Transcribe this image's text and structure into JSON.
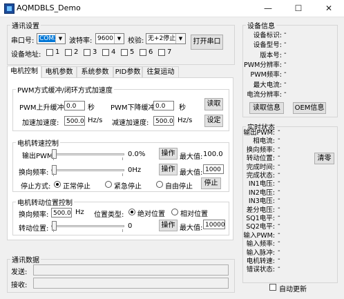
{
  "window": {
    "title": "AQMDBLS_Demo",
    "minimize": "—",
    "maximize": "☐",
    "close": "✕"
  },
  "comm": {
    "legend": "通讯设置",
    "port_label": "串口号:",
    "port_value": "COM1",
    "baud_label": "波特率:",
    "baud_value": "9600",
    "parity_label": "校验:",
    "parity_value": "无+2停止",
    "open_button": "打开串口",
    "addr_label": "设备地址:",
    "addresses": [
      "1",
      "2",
      "3",
      "4",
      "5",
      "6",
      "7"
    ]
  },
  "tabs": [
    "电机控制",
    "电机参数",
    "系统参数",
    "PID参数",
    "往复运动"
  ],
  "pwm": {
    "legend": "PWM方式缓冲/闭环方式加速度",
    "rise_label": "PWM上升缓冲:",
    "rise_value": "0.0",
    "rise_unit": "秒",
    "fall_label": "PWM下降缓冲:",
    "fall_value": "0.0",
    "fall_unit": "秒",
    "read_button": "读取",
    "accel_label": "加速加速度:",
    "accel_value": "500.0",
    "accel_unit": "Hz/s",
    "decel_label": "减速加速度:",
    "decel_value": "500.0",
    "decel_unit": "Hz/s",
    "set_button": "设定"
  },
  "speed": {
    "legend": "电机转速控制",
    "pwm_label": "输出PWM:",
    "pwm_readout": "0.0%",
    "pwm_level": 0.0,
    "pwm_op": "操作",
    "pwm_max_label": "最大值:",
    "pwm_max_value": "100.0",
    "freq_label": "换向频率:",
    "freq_readout": "0Hz",
    "freq_level": 0.0,
    "freq_op": "操作",
    "freq_max_label": "最大值:",
    "freq_max_value": "1000",
    "stop_label": "停止方式:",
    "stop_options": [
      "正常停止",
      "紧急停止",
      "自由停止"
    ],
    "stop_selected": 0,
    "stop_button": "停止"
  },
  "position": {
    "legend": "电机转动位置控制",
    "freq_label": "换向频率:",
    "freq_value": "500.0",
    "freq_unit": "Hz",
    "type_label": "位置类型:",
    "type_options": [
      "绝对位置",
      "相对位置"
    ],
    "type_selected": 0,
    "pos_label": "转动位置:",
    "pos_readout": "0",
    "pos_level": 0.0,
    "pos_op": "操作",
    "pos_max_label": "最大值:",
    "pos_max_value": "10000"
  },
  "comm_data": {
    "legend": "通讯数据",
    "send_label": "发送:",
    "recv_label": "接收:"
  },
  "device_info": {
    "legend": "设备信息",
    "rows": [
      {
        "label": "设备标识:",
        "value": "-"
      },
      {
        "label": "设备型号:",
        "value": "-"
      },
      {
        "label": "版本号:",
        "value": "-"
      },
      {
        "label": "PWM分辨率:",
        "value": "-"
      },
      {
        "label": "PWM频率:",
        "value": "-"
      },
      {
        "label": "最大电流:",
        "value": "-"
      },
      {
        "label": "电流分辨率:",
        "value": "-"
      }
    ],
    "read_button": "读取信息",
    "oem_button": "OEM信息"
  },
  "realtime": {
    "legend": "实时状态",
    "rows": [
      {
        "label": "输出PWM:",
        "value": "-"
      },
      {
        "label": "相电流:",
        "value": "-"
      },
      {
        "label": "换向频率:",
        "value": "-"
      },
      {
        "label": "转动位置:",
        "value": "-"
      },
      {
        "label": "完成时间:",
        "value": "-"
      },
      {
        "label": "完成状态:",
        "value": "-"
      },
      {
        "label": "IN1电压:",
        "value": "-"
      },
      {
        "label": "IN2电压:",
        "value": "-"
      },
      {
        "label": "IN3电压:",
        "value": "-"
      },
      {
        "label": "差分电压:",
        "value": "-"
      },
      {
        "label": "SQ1电平:",
        "value": "-"
      },
      {
        "label": "SQ2电平:",
        "value": "-"
      },
      {
        "label": "输入PWM:",
        "value": "-"
      },
      {
        "label": "输入频率:",
        "value": "-"
      },
      {
        "label": "输入脉冲:",
        "value": "-"
      },
      {
        "label": "电机转速:",
        "value": "-"
      },
      {
        "label": "错误状态:",
        "value": "-"
      }
    ],
    "clear_button": "清零",
    "auto_update": "自动更新"
  }
}
